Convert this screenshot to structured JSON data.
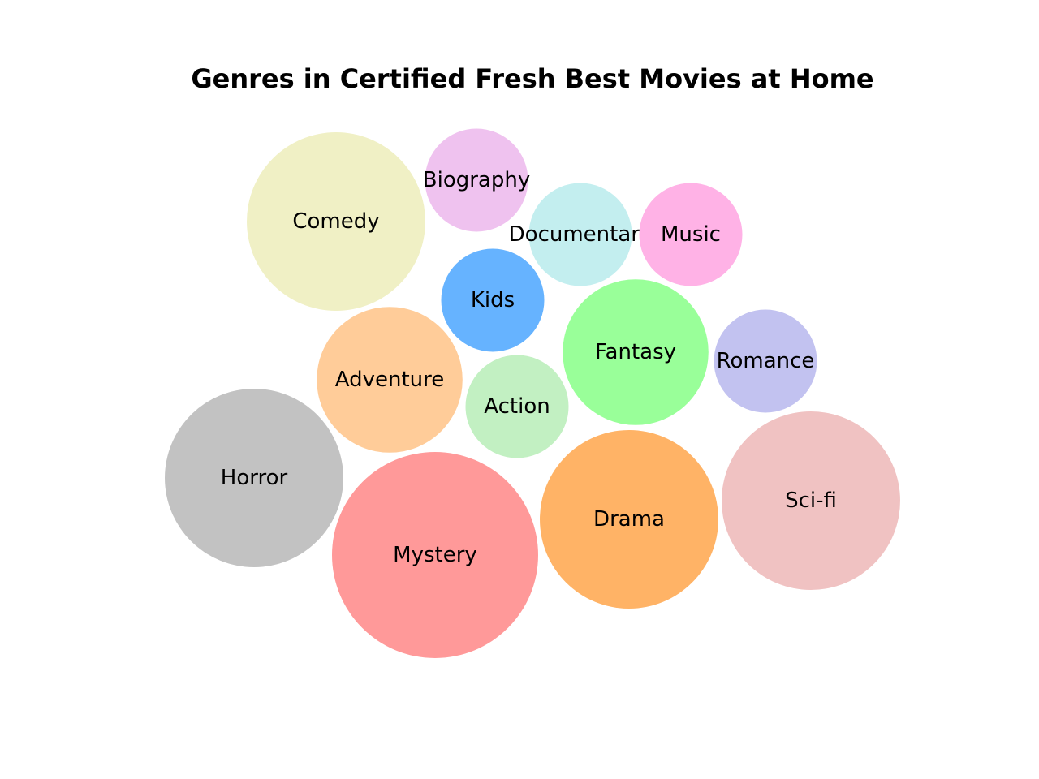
{
  "chart_data": {
    "type": "bubble",
    "title": "Genres in Certified Fresh Best Movies at Home",
    "series": [
      {
        "name": "Comedy",
        "value": 3,
        "color": "#f0f0c5"
      },
      {
        "name": "Biography",
        "value": 1,
        "color": "#efc2ef"
      },
      {
        "name": "Documentary",
        "value": 1,
        "color": "#c3eeef"
      },
      {
        "name": "Music",
        "value": 1,
        "color": "#ffb2e6"
      },
      {
        "name": "Kids",
        "value": 1,
        "color": "#66b3ff"
      },
      {
        "name": "Fantasy",
        "value": 2,
        "color": "#99ff99"
      },
      {
        "name": "Romance",
        "value": 1,
        "color": "#c2c2f0"
      },
      {
        "name": "Adventure",
        "value": 2,
        "color": "#ffcc99"
      },
      {
        "name": "Action",
        "value": 1,
        "color": "#c2f0c2"
      },
      {
        "name": "Horror",
        "value": 3,
        "color": "#c2c2c2"
      },
      {
        "name": "Mystery",
        "value": 4,
        "color": "#ff9999"
      },
      {
        "name": "Drama",
        "value": 3,
        "color": "#ffb366"
      },
      {
        "name": "Sci-fi",
        "value": 3,
        "color": "#f0c2c2"
      }
    ]
  }
}
